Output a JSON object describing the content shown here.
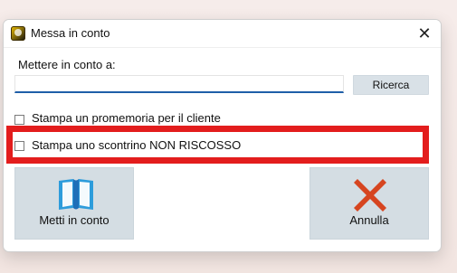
{
  "dialog": {
    "title": "Messa in conto",
    "label": "Mettere in conto a:",
    "input_value": "",
    "search_button": "Ricerca",
    "options": [
      {
        "label": "Stampa un promemoria per il cliente",
        "checked": false
      },
      {
        "label": "Stampa uno scontrino NON RISCOSSO",
        "checked": false
      }
    ],
    "actions": {
      "confirm": "Metti in conto",
      "cancel": "Annulla"
    },
    "icons": {
      "app": "app-icon",
      "close": "close-icon",
      "confirm": "book-icon",
      "cancel": "x-icon"
    }
  },
  "colors": {
    "highlight": "#e31d1d",
    "input_accent": "#1f5fa8",
    "button_bg": "#d4dde3",
    "cancel_icon": "#d64520",
    "book_icon": "#2d9cdb"
  }
}
